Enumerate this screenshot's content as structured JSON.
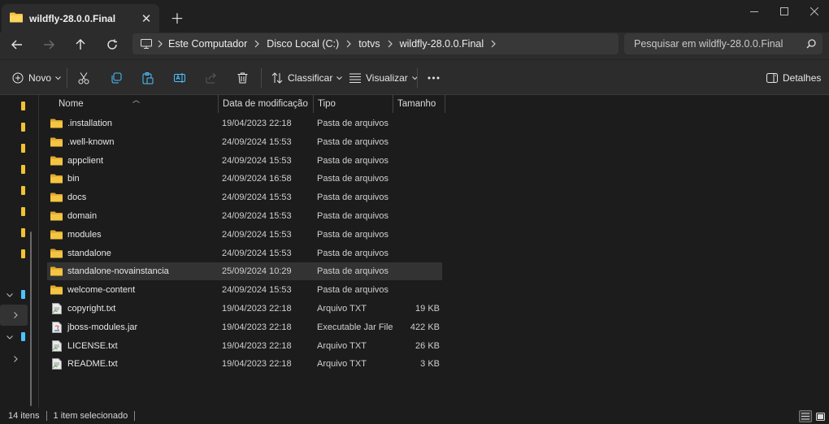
{
  "window": {
    "tab_title": "wildfly-28.0.0.Final"
  },
  "address": {
    "breadcrumbs": [
      "Este Computador",
      "Disco Local (C:)",
      "totvs",
      "wildfly-28.0.0.Final"
    ],
    "search_placeholder": "Pesquisar em wildfly-28.0.0.Final"
  },
  "toolbar": {
    "new_label": "Novo",
    "sort_label": "Classificar",
    "view_label": "Visualizar",
    "details_label": "Detalhes"
  },
  "columns": {
    "name": "Nome",
    "date": "Data de modificação",
    "type": "Tipo",
    "size": "Tamanho"
  },
  "files": [
    {
      "name": ".installation",
      "date": "19/04/2023 22:18",
      "type": "Pasta de arquivos",
      "size": "",
      "icon": "folder-icon"
    },
    {
      "name": ".well-known",
      "date": "24/09/2024 15:53",
      "type": "Pasta de arquivos",
      "size": "",
      "icon": "folder-icon"
    },
    {
      "name": "appclient",
      "date": "24/09/2024 15:53",
      "type": "Pasta de arquivos",
      "size": "",
      "icon": "folder-icon"
    },
    {
      "name": "bin",
      "date": "24/09/2024 16:58",
      "type": "Pasta de arquivos",
      "size": "",
      "icon": "folder-icon"
    },
    {
      "name": "docs",
      "date": "24/09/2024 15:53",
      "type": "Pasta de arquivos",
      "size": "",
      "icon": "folder-icon"
    },
    {
      "name": "domain",
      "date": "24/09/2024 15:53",
      "type": "Pasta de arquivos",
      "size": "",
      "icon": "folder-icon"
    },
    {
      "name": "modules",
      "date": "24/09/2024 15:53",
      "type": "Pasta de arquivos",
      "size": "",
      "icon": "folder-icon"
    },
    {
      "name": "standalone",
      "date": "24/09/2024 15:53",
      "type": "Pasta de arquivos",
      "size": "",
      "icon": "folder-icon"
    },
    {
      "name": "standalone-novainstancia",
      "date": "25/09/2024 10:29",
      "type": "Pasta de arquivos",
      "size": "",
      "icon": "folder-icon",
      "selected": true
    },
    {
      "name": "welcome-content",
      "date": "24/09/2024 15:53",
      "type": "Pasta de arquivos",
      "size": "",
      "icon": "folder-icon"
    },
    {
      "name": "copyright.txt",
      "date": "19/04/2023 22:18",
      "type": "Arquivo TXT",
      "size": "19 KB",
      "icon": "text-file-icon"
    },
    {
      "name": "jboss-modules.jar",
      "date": "19/04/2023 22:18",
      "type": "Executable Jar File",
      "size": "422 KB",
      "icon": "jar-file-icon"
    },
    {
      "name": "LICENSE.txt",
      "date": "19/04/2023 22:18",
      "type": "Arquivo TXT",
      "size": "26 KB",
      "icon": "text-file-icon"
    },
    {
      "name": "README.txt",
      "date": "19/04/2023 22:18",
      "type": "Arquivo TXT",
      "size": "3 KB",
      "icon": "text-file-icon"
    }
  ],
  "status": {
    "item_count": "14 itens",
    "selection": "1 item selecionado"
  },
  "colors": {
    "folder": "#f4c542",
    "background": "#1c1c1c",
    "toolbar": "#2c2c2c",
    "accent": "#4cc2ff"
  }
}
